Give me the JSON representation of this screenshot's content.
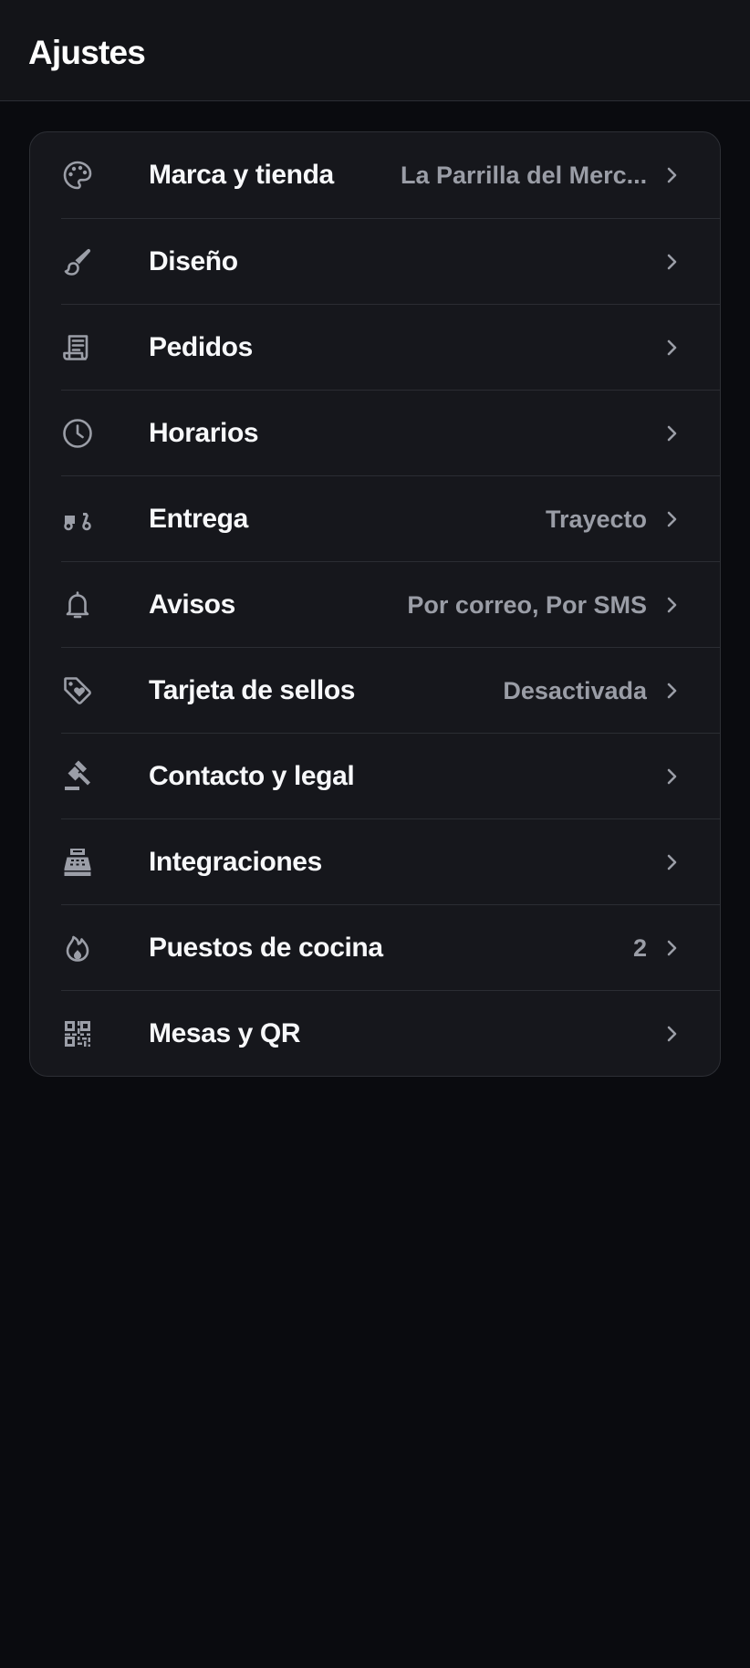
{
  "header": {
    "title": "Ajustes"
  },
  "colors": {
    "background": "#0a0b0f",
    "card": "#16171c",
    "text": "#f7f8fa",
    "muted": "#9a9da6"
  },
  "settings": [
    {
      "label": "Marca y tienda",
      "value": "La Parrilla del Merc...",
      "icon": "palette-icon"
    },
    {
      "label": "Diseño",
      "value": "",
      "icon": "brush-icon"
    },
    {
      "label": "Pedidos",
      "value": "",
      "icon": "receipt-icon"
    },
    {
      "label": "Horarios",
      "value": "",
      "icon": "clock-icon"
    },
    {
      "label": "Entrega",
      "value": "Trayecto",
      "icon": "scooter-icon"
    },
    {
      "label": "Avisos",
      "value": "Por correo, Por SMS",
      "icon": "bell-icon"
    },
    {
      "label": "Tarjeta de sellos",
      "value": "Desactivada",
      "icon": "tag-heart-icon"
    },
    {
      "label": "Contacto y legal",
      "value": "",
      "icon": "gavel-icon"
    },
    {
      "label": "Integraciones",
      "value": "",
      "icon": "cash-register-icon"
    },
    {
      "label": "Puestos de cocina",
      "value": "2",
      "icon": "flame-icon"
    },
    {
      "label": "Mesas y QR",
      "value": "",
      "icon": "qr-code-icon"
    }
  ]
}
